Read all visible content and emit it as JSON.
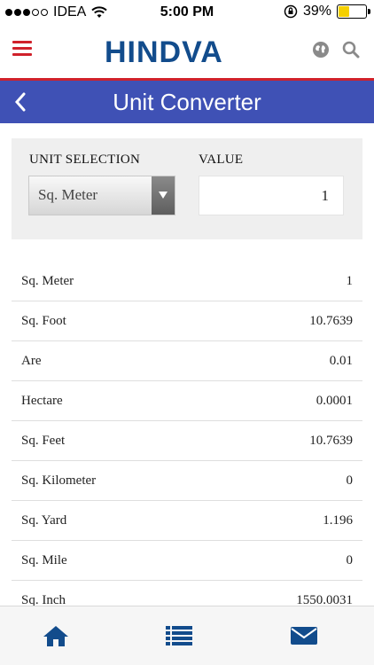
{
  "status_bar": {
    "carrier": "IDEA",
    "time": "5:00 PM",
    "battery_percent": "39%",
    "battery_level": 0.39,
    "icons": [
      "signal-dots-icon",
      "wifi-icon",
      "orientation-lock-icon",
      "battery-icon"
    ]
  },
  "header": {
    "logo_text": "HINDVA",
    "brand_color": "#124c8c",
    "accent_color": "#d0212b",
    "icons": [
      "menu-icon",
      "globe-icon",
      "search-icon"
    ]
  },
  "title_bar": {
    "title": "Unit Converter",
    "color": "#3f51b5"
  },
  "selection": {
    "unit_label": "UNIT SELECTION",
    "value_label": "VALUE",
    "selected_unit": "Sq. Meter",
    "value": "1"
  },
  "results": [
    {
      "name": "Sq. Meter",
      "value": "1"
    },
    {
      "name": "Sq. Foot",
      "value": "10.7639"
    },
    {
      "name": "Are",
      "value": "0.01"
    },
    {
      "name": "Hectare",
      "value": "0.0001"
    },
    {
      "name": "Sq. Feet",
      "value": "10.7639"
    },
    {
      "name": "Sq. Kilometer",
      "value": "0"
    },
    {
      "name": "Sq. Yard",
      "value": "1.196"
    },
    {
      "name": "Sq. Mile",
      "value": "0"
    },
    {
      "name": "Sq. Inch",
      "value": "1550.0031"
    }
  ],
  "bottom_nav": {
    "items": [
      "home-icon",
      "list-icon",
      "mail-icon"
    ],
    "icon_color": "#124c8c"
  }
}
